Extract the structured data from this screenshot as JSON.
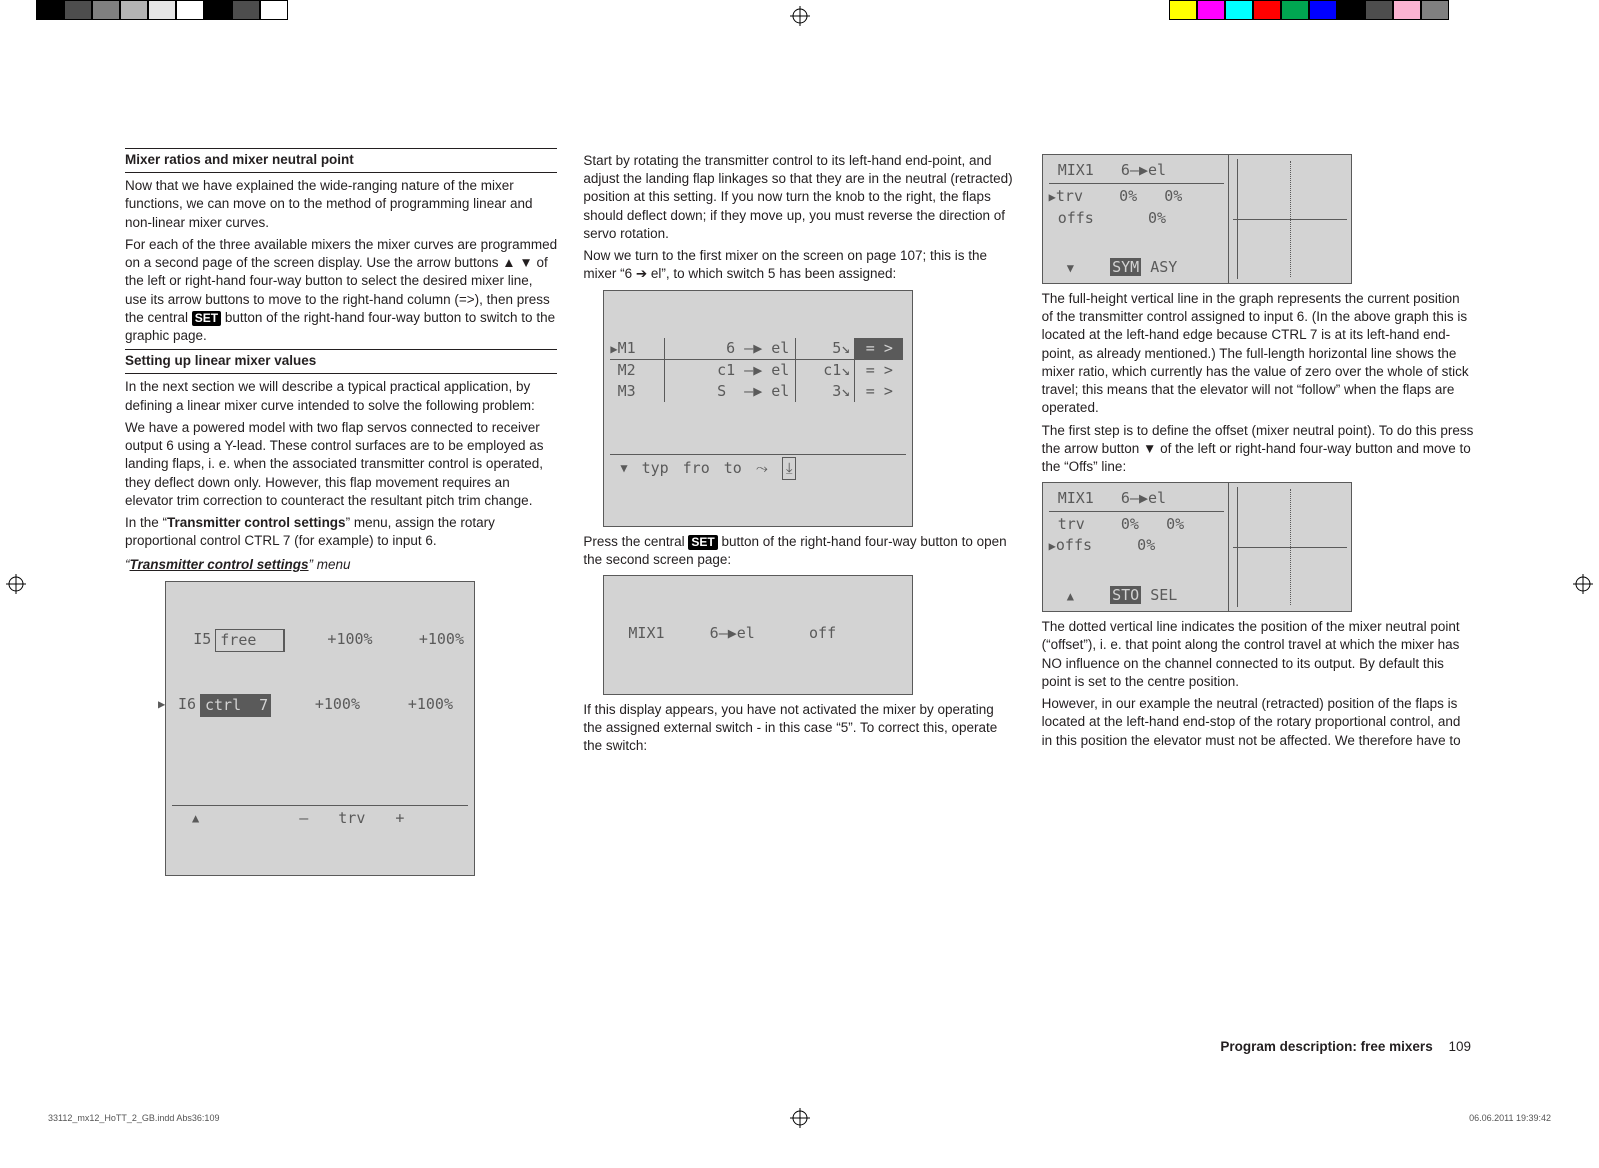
{
  "col1": {
    "h1": "Mixer ratios and mixer neutral point",
    "p1": "Now that we have explained the wide-ranging nature of the mixer functions, we can move on to the method of programming linear and non-linear mixer curves.",
    "p2a": "For each of the three available mixers the mixer curves are programmed on a second page of the screen display. Use the arrow buttons ▲ ▼ of the left or right-hand four-way button to select the desired mixer line, use its arrow buttons to move to the right-hand column (=>), then press the central ",
    "set": "SET",
    "p2b": " button of the right-hand four-way button to switch to the graphic page.",
    "h2": "Setting up linear mixer values",
    "p3": "In the next section we will describe a typical practical application, by defining a linear mixer curve intended to solve the following problem:",
    "p4": "We have a powered model with two flap servos con­nected to receiver output 6 using a Y-lead. These control surfaces are to be employed as landing flaps, i. e. when the associated transmitter control is operated, they deflect down only. However, this flap movement requires an elevator trim correction to counteract the resultant pitch trim change.",
    "p5a": "In the “",
    "p5b": "Transmitter control settings",
    "p5c": "” menu, assign the rotary proportional control CTRL 7 (for example) to input 6.",
    "menu_caption_a": "“",
    "menu_caption_b": "Transmitter control settings",
    "menu_caption_c": "” menu",
    "lcd_ctrl": {
      "r1": {
        "a": "I5",
        "b": "free",
        "c": "+100%",
        "d": "+100%"
      },
      "r2": {
        "a": "I6",
        "b": "ctrl  7",
        "c": "+100%",
        "d": "+100%"
      },
      "footer": {
        "arrow": "▲",
        "minus": "–",
        "label": "trv",
        "plus": "+"
      },
      "pointer": "▶"
    }
  },
  "col2": {
    "p1": "Start by rotating the transmitter control to its left-hand end-point, and adjust the landing flap linkages so that they are in the neutral (retracted) position at this setting. If you now turn the knob to the right, the flaps should deflect down; if they move up, you must reverse the direction of servo rotation.",
    "p2": "Now we turn to the first mixer on the screen on page 107; this is the mixer “6 ➔ el”, to which switch 5 has been assigned:",
    "lcd_mix": {
      "rows": [
        {
          "m": "M1",
          "pointer": "▶",
          "mix": "6 –▶ el",
          "sw": "5↘",
          "go_inv": true,
          "go": "= >"
        },
        {
          "m": "M2",
          "pointer": "",
          "mix": "c1 –▶ el",
          "sw": "c1↘",
          "go_inv": false,
          "go": "= >"
        },
        {
          "m": "M3",
          "pointer": "",
          "mix": "S  –▶ el",
          "sw": "3↘",
          "go_inv": false,
          "go": "= >"
        }
      ],
      "footer": {
        "arrow": "▼",
        "typ": "typ",
        "fro": "fro",
        "to": "to",
        "curve": "⤳",
        "box": "⤓"
      }
    },
    "p3a": "Press the central ",
    "p3b": " button of the right-hand four-way button to open the second screen page:",
    "lcd_off": {
      "title": "MIX1",
      "mix": "6–▶el",
      "state": "off"
    },
    "p4": "If this display appears, you have not activated the mixer by operating the assigned external switch - in this case “5”. To correct this, operate the switch:"
  },
  "col3": {
    "lcdA": {
      "title": "MIX1",
      "mix": "6–▶el",
      "rows": [
        {
          "label": "trv",
          "pointer": "▶",
          "v1": "0%",
          "v2": "0%"
        },
        {
          "label": "offs",
          "pointer": "",
          "v1": "0%",
          "v2": ""
        }
      ],
      "footer": {
        "arrow": "▼",
        "a_inv": "SYM",
        "b": "ASY"
      }
    },
    "p1": "The full-height vertical line in the graph represents the current position of the transmitter control assigned to input 6. (In the above graph this is located at the left-hand edge because CTRL 7 is at its left-hand end-point, as already mentioned.) The full-length horizontal line shows the mixer ratio, which currently has the value of zero over the whole of stick travel; this means that the elevator will not “follow” when the flaps are operated.",
    "p2": "The first step is to define the offset (mixer neutral point). To do this press the arrow button ▼ of the left or right-hand four-way button and move to the “Offs” line:",
    "lcdB": {
      "title": "MIX1",
      "mix": "6–▶el",
      "rows": [
        {
          "label": "trv",
          "pointer": "",
          "v1": "0%",
          "v2": "0%"
        },
        {
          "label": "offs",
          "pointer": "▶",
          "v1": "0%",
          "v2": ""
        }
      ],
      "footer": {
        "arrow": "▲",
        "a_inv": "STO",
        "b": "SEL"
      }
    },
    "p3": "The dotted vertical line indicates the position of the mixer neutral point (“offset”), i. e. that point along the control travel at which the mixer has NO influence on the channel connected to its output. By default this point is set to the centre position.",
    "p4": "However, in our example the neutral (retracted) posi­tion of the flaps is located at the left-hand end-stop of the rotary proportional control, and in this position the elevator must not be affected. We therefore have to"
  },
  "footer": {
    "title": "Program description: free mixers",
    "page": "109"
  },
  "slug": {
    "file": "33112_mx12_HoTT_2_GB.indd   Abs36:109",
    "date": "06.06.2011   19:39:42"
  },
  "colorbars_left": [
    "#000000",
    "#4d4d4d",
    "#808080",
    "#b3b3b3",
    "#e6e6e6",
    "#ffffff",
    "#000000",
    "#4d4d4d",
    "#ffffff"
  ],
  "colorbars_right": [
    "#ffff00",
    "#ff00ff",
    "#00ffff",
    "#ff0000",
    "#00a651",
    "#0000ff",
    "#000000",
    "#4d4d4d",
    "#fbb3d1",
    "#808080"
  ]
}
